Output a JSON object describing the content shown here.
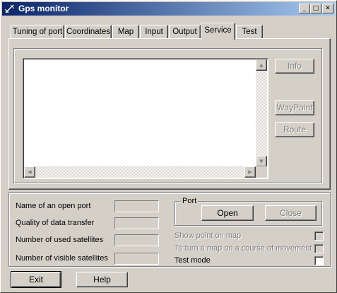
{
  "window": {
    "title": "Gps monitor",
    "controls": {
      "minimize": "0",
      "maximize": "1",
      "close": "r"
    }
  },
  "tabs": [
    {
      "label": "Tuning of port",
      "active": false
    },
    {
      "label": "Coordinates",
      "active": false
    },
    {
      "label": "Map",
      "active": false
    },
    {
      "label": "Input",
      "active": false
    },
    {
      "label": "Output",
      "active": false
    },
    {
      "label": "Service",
      "active": true
    },
    {
      "label": "Test",
      "active": false
    }
  ],
  "service": {
    "buttons": {
      "info": "Info",
      "waypoint": "WayPoint",
      "route": "Route"
    }
  },
  "status": {
    "open_port_label": "Name of an open port",
    "quality_label": "Quality of data transfer",
    "used_sats_label": "Number of used satellites",
    "visible_sats_label": "Number of visible satellites",
    "open_port_value": "",
    "quality_value": "",
    "used_sats_value": "",
    "visible_sats_value": ""
  },
  "port": {
    "group_title": "Port",
    "open_label": "Open",
    "close_label": "Close"
  },
  "options": {
    "show_point": "Show point on map",
    "turn_map": "To turn a map on a course of movement",
    "test_mode": "Test mode"
  },
  "footer": {
    "exit_label": "Exit",
    "help_label": "Help"
  },
  "colors": {
    "face": "#d4d0c8",
    "title_start": "#0a246a",
    "title_end": "#a6caf0",
    "disabled_text": "#808080"
  }
}
